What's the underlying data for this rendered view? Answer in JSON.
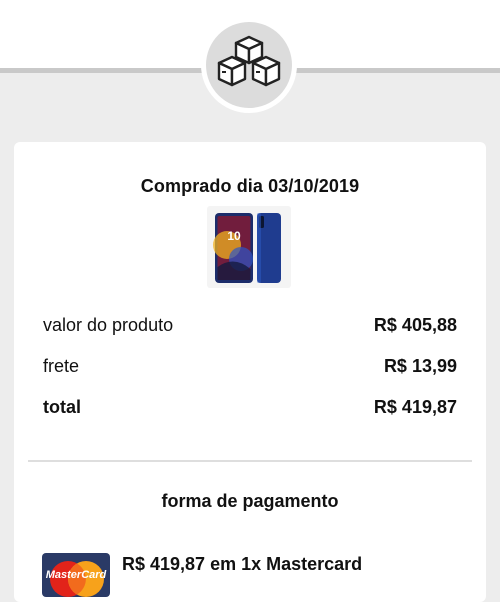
{
  "purchase": {
    "title": "Comprado dia 03/10/2019"
  },
  "product": {
    "image_alt": "Smartphone azul"
  },
  "summary": {
    "rows": [
      {
        "label": "valor do produto",
        "value": "R$ 405,88"
      },
      {
        "label": "frete",
        "value": "R$ 13,99"
      },
      {
        "label": "total",
        "value": "R$ 419,87"
      }
    ]
  },
  "payment": {
    "title": "forma de pagamento",
    "text": "R$ 419,87 em 1x Mastercard",
    "card_brand": "MasterCard"
  },
  "icons": {
    "header": "boxes-icon",
    "card": "mastercard-icon"
  },
  "colors": {
    "background": "#ededed",
    "card": "#ffffff",
    "icon_circle": "#dcdcdc",
    "mastercard_red": "#e2231a",
    "mastercard_yellow": "#f7a21b"
  }
}
